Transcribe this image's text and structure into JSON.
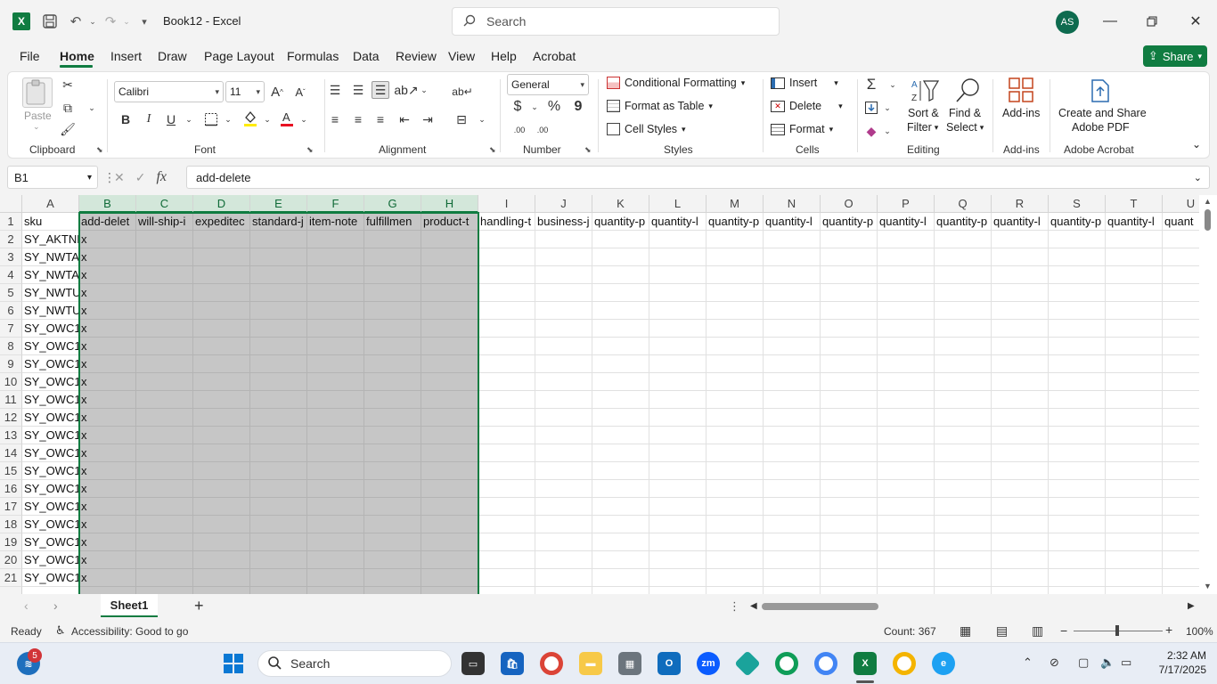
{
  "window": {
    "doc_title": "Book12  -  Excel",
    "search_placeholder": "Search",
    "avatar_initials": "AS",
    "brand_color": "#107c41"
  },
  "menu": {
    "tabs": [
      "File",
      "Home",
      "Insert",
      "Draw",
      "Page Layout",
      "Formulas",
      "Data",
      "Review",
      "View",
      "Help",
      "Acrobat"
    ],
    "active": "Home",
    "share_label": "Share"
  },
  "ribbon": {
    "clipboard": {
      "paste": "Paste",
      "label": "Clipboard"
    },
    "font": {
      "name": "Calibri",
      "size": "11",
      "bold": "B",
      "italic": "I",
      "underline": "U",
      "label": "Font"
    },
    "alignment": {
      "label": "Alignment"
    },
    "number": {
      "format": "General",
      "currency": "$",
      "percent": "%",
      "comma": "9",
      "inc_dec": ".00",
      "label": "Number"
    },
    "styles": {
      "conditional": "Conditional Formatting",
      "table": "Format as Table",
      "cellstyles": "Cell Styles",
      "label": "Styles"
    },
    "cells": {
      "insert": "Insert",
      "delete": "Delete",
      "format": "Format",
      "label": "Cells"
    },
    "editing": {
      "sort": "Sort &",
      "sort2": "Filter",
      "find": "Find &",
      "find2": "Select",
      "label": "Editing"
    },
    "addins": {
      "btn": "Add-ins",
      "label": "Add-ins"
    },
    "acrobat": {
      "btn1": "Create and Share",
      "btn2": "Adobe PDF",
      "label": "Adobe Acrobat"
    }
  },
  "formula_bar": {
    "name_box": "B1",
    "formula": "add-delete"
  },
  "sheet": {
    "columns": [
      "A",
      "B",
      "C",
      "D",
      "E",
      "F",
      "G",
      "H",
      "I",
      "J",
      "K",
      "L",
      "M",
      "N",
      "O",
      "P",
      "Q",
      "R",
      "S",
      "T",
      "U"
    ],
    "selected_columns": [
      "B",
      "C",
      "D",
      "E",
      "F",
      "G",
      "H"
    ],
    "rows": [
      1,
      2,
      3,
      4,
      5,
      6,
      7,
      8,
      9,
      10,
      11,
      12,
      13,
      14,
      15,
      16,
      17,
      18,
      19,
      20,
      21
    ],
    "header_row": [
      "sku",
      "add-delet",
      "will-ship-i",
      "expeditec",
      "standard-j",
      "item-note",
      "fulfillmen",
      "product-t",
      "handling-t",
      "business-j",
      "quantity-p",
      "quantity-l",
      "quantity-p",
      "quantity-l",
      "quantity-p",
      "quantity-l",
      "quantity-p",
      "quantity-l",
      "quantity-p",
      "quantity-l",
      "quant"
    ],
    "col_a": [
      "SY_AKTNF",
      "SY_NWTA",
      "SY_NWTA",
      "SY_NWTU",
      "SY_NWTU",
      "SY_OWC1",
      "SY_OWC1",
      "SY_OWC1",
      "SY_OWC1",
      "SY_OWC1",
      "SY_OWC1",
      "SY_OWC1",
      "SY_OWC1",
      "SY_OWC1",
      "SY_OWC1",
      "SY_OWC1",
      "SY_OWC1",
      "SY_OWC1",
      "SY_OWC1",
      "SY_OWC1"
    ],
    "col_b_value": "x",
    "active_sheet": "Sheet1"
  },
  "status": {
    "ready": "Ready",
    "accessibility": "Accessibility: Good to go",
    "count": "Count: 367",
    "zoom": "100%"
  },
  "taskbar": {
    "search": "Search",
    "time": "2:32 AM",
    "date": "7/17/2025",
    "notif_badge": "5"
  }
}
